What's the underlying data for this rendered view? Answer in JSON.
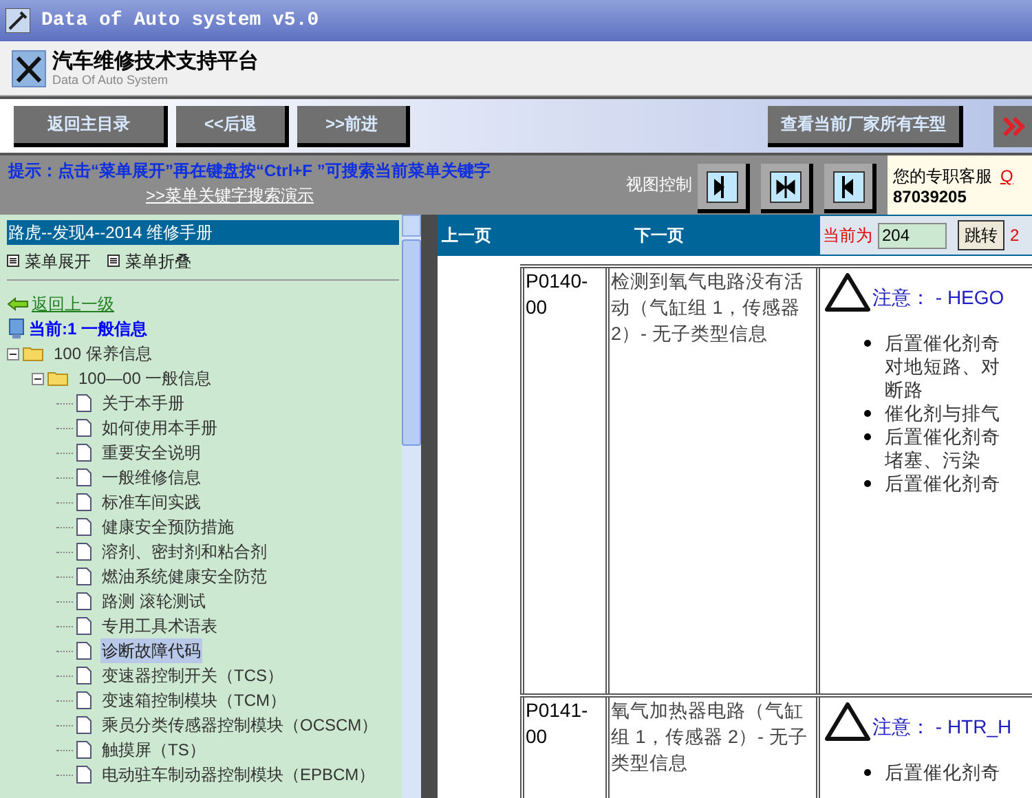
{
  "window": {
    "title": "Data of Auto system v5.0"
  },
  "header": {
    "title": "汽车维修技术支持平台",
    "subtitle": "Data Of Auto System"
  },
  "toolbar": {
    "buttons": [
      "返回主目录",
      "<<后退",
      ">>前进"
    ],
    "right_button": "查看当前厂家所有车型"
  },
  "hint": {
    "text": "提示：点击“菜单展开”再在键盘按“Ctrl+F ”可搜索当前菜单关键字",
    "link": ">>菜单关键字搜索演示"
  },
  "view_control": {
    "label": "视图控制"
  },
  "service": {
    "label": "您的专职客服",
    "qq": "Q",
    "phone": "87039205"
  },
  "sidebar": {
    "title": "路虎--发现4--2014 维修手册",
    "expand": "菜单展开",
    "collapse": "菜单折叠",
    "back": "返回上一级",
    "current": "当前:1 一般信息",
    "tree": [
      {
        "label": "100 保养信息",
        "expanded": true,
        "selected": false,
        "children": [
          {
            "label": "100—00 一般信息",
            "expanded": true,
            "selected": false,
            "children": [
              {
                "label": "关于本手册",
                "selected": false
              },
              {
                "label": "如何使用本手册",
                "selected": false
              },
              {
                "label": "重要安全说明",
                "selected": false
              },
              {
                "label": "一般维修信息",
                "selected": false
              },
              {
                "label": "标准车间实践",
                "selected": false
              },
              {
                "label": "健康安全预防措施",
                "selected": false
              },
              {
                "label": "溶剂、密封剂和粘合剂",
                "selected": false
              },
              {
                "label": "燃油系统健康安全防范",
                "selected": false
              },
              {
                "label": "路测 滚轮测试",
                "selected": false
              },
              {
                "label": "专用工具术语表",
                "selected": false
              },
              {
                "label": "诊断故障代码",
                "selected": true
              },
              {
                "label": "变速器控制开关（TCS）",
                "selected": false
              },
              {
                "label": "变速箱控制模块（TCM）",
                "selected": false
              },
              {
                "label": "乘员分类传感器控制模块（OCSCM）",
                "selected": false
              },
              {
                "label": "触摸屏（TS）",
                "selected": false
              },
              {
                "label": "电动驻车制动器控制模块（EPBCM）",
                "selected": false
              }
            ]
          }
        ]
      }
    ]
  },
  "pager": {
    "prev": "上一页",
    "next": "下一页",
    "current_label": "当前为",
    "page": "204",
    "go": "跳转",
    "extra": "2"
  },
  "table": {
    "rows": [
      {
        "code": "P0140-00",
        "description": "检测到氧气电路没有活动（气缸组 1，传感器 2）- 无子类型信息",
        "note": "注意： - HEGO",
        "bullets": [
          [
            "后置催化剂奇",
            "对地短路、对",
            "断路"
          ],
          [
            "催化剂与排气"
          ],
          [
            "后置催化剂奇",
            "堵塞、污染"
          ],
          [
            "后置催化剂奇"
          ]
        ]
      },
      {
        "code": "P0141-00",
        "description": "氧气加热器电路（气缸组 1，传感器 2）- 无子类型信息",
        "note": "注意： - HTR_H",
        "bullets": [
          [
            "后置催化剂奇"
          ]
        ]
      }
    ]
  }
}
